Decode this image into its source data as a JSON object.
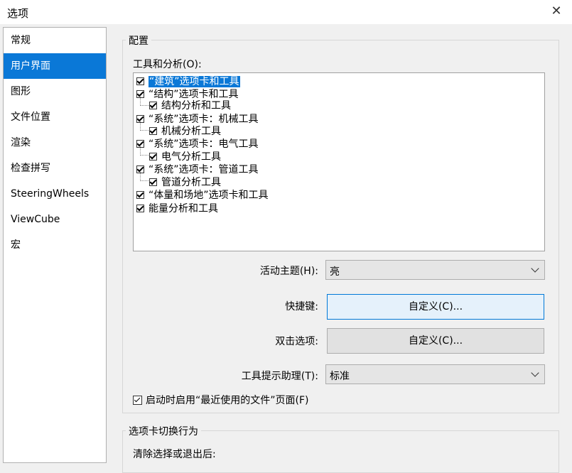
{
  "window": {
    "title": "选项",
    "close_glyph": "✕"
  },
  "sidebar": {
    "items": [
      {
        "label": "常规",
        "selected": false
      },
      {
        "label": "用户界面",
        "selected": true
      },
      {
        "label": "图形",
        "selected": false
      },
      {
        "label": "文件位置",
        "selected": false
      },
      {
        "label": "渲染",
        "selected": false
      },
      {
        "label": "检查拼写",
        "selected": false
      },
      {
        "label": "SteeringWheels",
        "selected": false
      },
      {
        "label": "ViewCube",
        "selected": false
      },
      {
        "label": "宏",
        "selected": false
      }
    ]
  },
  "config": {
    "group_title": "配置",
    "tools_label": "工具和分析(O):",
    "tree": [
      {
        "label": "“建筑”选项卡和工具",
        "checked": true,
        "level": 0,
        "highlighted": true
      },
      {
        "label": "“结构”选项卡和工具",
        "checked": true,
        "level": 0
      },
      {
        "label": "结构分析和工具",
        "checked": true,
        "level": 1
      },
      {
        "label": "“系统”选项卡：机械工具",
        "checked": true,
        "level": 0
      },
      {
        "label": "机械分析工具",
        "checked": true,
        "level": 1
      },
      {
        "label": "“系统”选项卡：电气工具",
        "checked": true,
        "level": 0
      },
      {
        "label": "电气分析工具",
        "checked": true,
        "level": 1
      },
      {
        "label": "“系统”选项卡：管道工具",
        "checked": true,
        "level": 0
      },
      {
        "label": "管道分析工具",
        "checked": true,
        "level": 1
      },
      {
        "label": "“体量和场地”选项卡和工具",
        "checked": true,
        "level": 0
      },
      {
        "label": "能量分析和工具",
        "checked": true,
        "level": 0
      }
    ],
    "theme": {
      "label": "活动主题(H):",
      "value": "亮"
    },
    "shortcuts": {
      "label": "快捷键:",
      "button": "自定义(C)..."
    },
    "double_click": {
      "label": "双击选项:",
      "button": "自定义(C)..."
    },
    "tooltip": {
      "label": "工具提示助理(T):",
      "value": "标准"
    },
    "startup": {
      "label": "启动时启用“最近使用的文件”页面(F)",
      "checked": true
    }
  },
  "tab_switch": {
    "group_title": "选项卡切换行为",
    "clear_label": "清除选择或退出后:"
  },
  "icons": {
    "close": "close-icon",
    "dropdown": "chevron-down-icon",
    "checkbox": "checkbox-icon"
  },
  "colors": {
    "accent": "#0a78d7",
    "focus_border": "#0078d7",
    "focus_fill": "#e5f1fb"
  }
}
